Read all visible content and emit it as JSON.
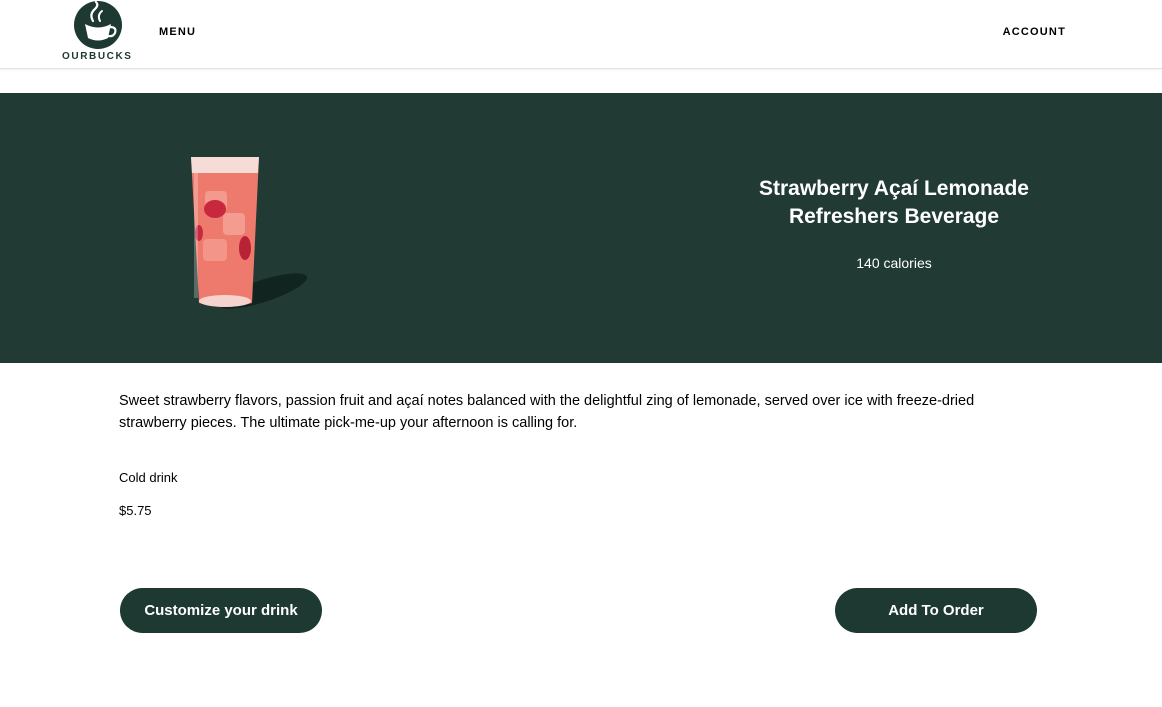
{
  "brand": {
    "name": "OURBUCKS",
    "primary_color": "#1e3932",
    "hero_color": "#213b34"
  },
  "nav": {
    "menu_label": "MENU",
    "account_label": "ACCOUNT"
  },
  "product": {
    "title": "Strawberry Açaí Lemonade Refreshers Beverage",
    "calories": "140 calories",
    "description": "Sweet strawberry flavors, passion fruit and açaí notes balanced with the delightful zing of lemonade, served over ice with freeze-dried strawberry pieces. The ultimate pick-me-up your afternoon is calling for.",
    "category": "Cold drink",
    "price": "$5.75",
    "image_icon": "iced-drink-glass-image"
  },
  "actions": {
    "customize_label": "Customize your drink",
    "add_label": "Add To Order"
  }
}
